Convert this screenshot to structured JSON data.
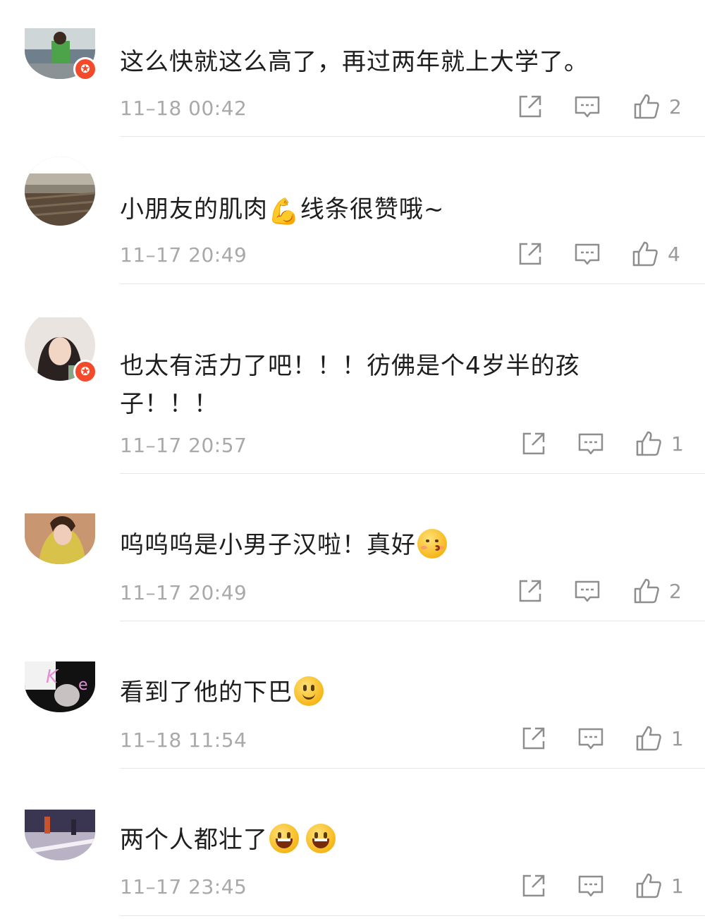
{
  "comments": [
    {
      "text": "这么快就这么高了，再过两年就上大学了。",
      "time": "11–18 00:42",
      "likes": "2",
      "avatar_colors": [
        "#6f7f8c",
        "#cfd6d8",
        "#4ca34a"
      ],
      "verified": true
    },
    {
      "text_a": "小朋友的肌肉",
      "text_b": "线条很赞哦~",
      "emoji": "💪",
      "time": "11–17 20:49",
      "likes": "4",
      "avatar_colors": [
        "#8a8275",
        "#b9b3a6",
        "#5b4a3a"
      ],
      "verified": false
    },
    {
      "text": "也太有活力了吧！！！彷佛是个4岁半的孩子！！！",
      "time": "11–17 20:57",
      "likes": "1",
      "avatar_colors": [
        "#e9e4e0",
        "#2a2220",
        "#88a58a"
      ],
      "verified": true
    },
    {
      "text": "呜呜呜是小男子汉啦！真好",
      "time": "11–17 20:49",
      "likes": "2",
      "avatar_colors": [
        "#d9c24a",
        "#a14a2e",
        "#e8d7a8"
      ],
      "verified": false
    },
    {
      "text": "看到了他的下巴",
      "time": "11–18 11:54",
      "likes": "1",
      "avatar_colors": [
        "#f2f2f2",
        "#111111",
        "#e58fd6"
      ],
      "verified": false
    },
    {
      "text": "两个人都壮了",
      "time": "11–17 23:45",
      "likes": "1",
      "avatar_colors": [
        "#3a3550",
        "#d7d4d8",
        "#b8b2c4"
      ],
      "verified": false
    }
  ],
  "icons": {
    "share": "share-icon",
    "reply": "reply-icon",
    "like": "thumbs-up-icon",
    "verified": "verified-badge-icon"
  },
  "colors": {
    "badge": "#f24a2b",
    "meta": "#a9a9a9",
    "icon": "#8e8e8e"
  }
}
